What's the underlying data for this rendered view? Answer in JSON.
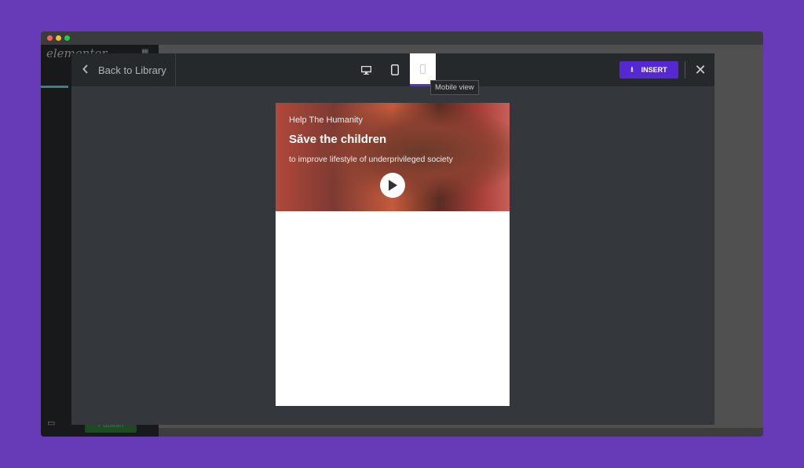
{
  "editor": {
    "logo": "elementor",
    "publish_label": "Publish"
  },
  "header": {
    "back_label": "Back to Library",
    "tooltip": "Mobile view",
    "insert_label": "INSERT",
    "devices": [
      "desktop",
      "tablet",
      "mobile"
    ],
    "active_device": "mobile"
  },
  "preview": {
    "kicker": "Help The Humanity",
    "title": "Săve the children",
    "subtitle": "to improve lifestyle of underprivileged society"
  },
  "colors": {
    "background": "#673ab7",
    "accent": "#5528d4"
  }
}
